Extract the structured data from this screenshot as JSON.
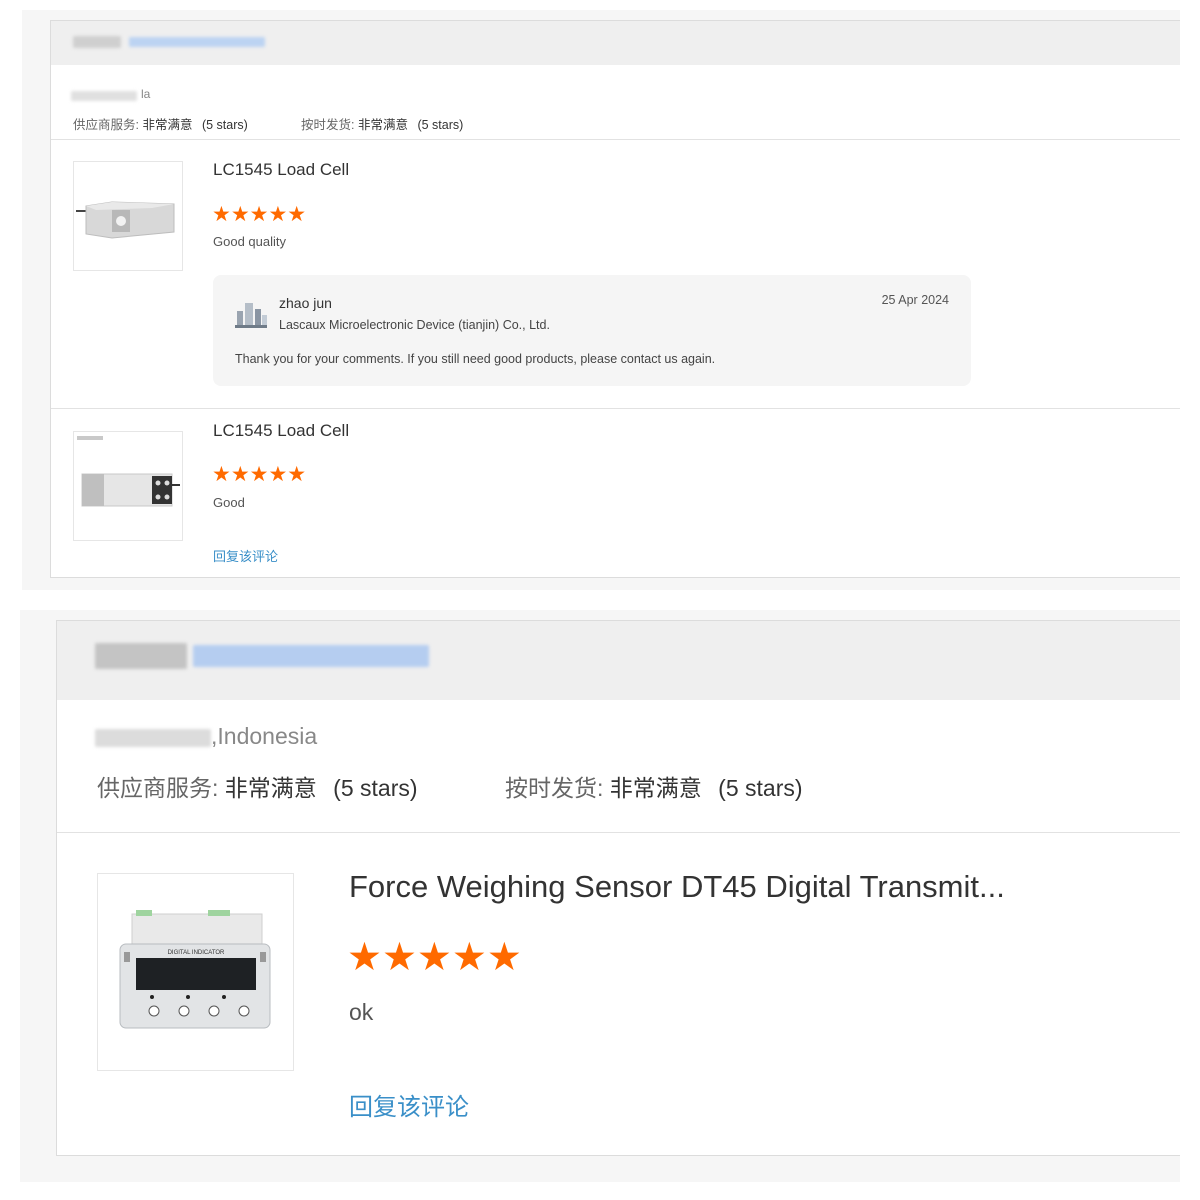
{
  "review1": {
    "location_suffix": "la",
    "ratings": [
      {
        "label": "供应商服务:",
        "value": "非常满意",
        "stars": "(5 stars)"
      },
      {
        "label": "按时发货:",
        "value": "非常满意",
        "stars": "(5 stars)"
      }
    ],
    "items": [
      {
        "product": "LC1545 Load Cell",
        "rating": 5,
        "stars": "★★★★★",
        "comment": "Good quality",
        "reply": {
          "author": "zhao jun",
          "company": "Lascaux Microelectronic Device (tianjin) Co., Ltd.",
          "date": "25 Apr 2024",
          "text": "Thank you for your comments. If you still need good products, please contact us again."
        }
      },
      {
        "product": "LC1545 Load Cell",
        "rating": 5,
        "stars": "★★★★★",
        "comment": "Good",
        "reply_link": "回复该评论"
      }
    ]
  },
  "review2": {
    "location_suffix": ",Indonesia",
    "ratings": [
      {
        "label": "供应商服务:",
        "value": "非常满意",
        "stars": "(5 stars)"
      },
      {
        "label": "按时发货:",
        "value": "非常满意",
        "stars": "(5 stars)"
      }
    ],
    "item": {
      "product": "Force Weighing Sensor DT45 Digital Transmit...",
      "rating": 5,
      "stars": "★★★★★",
      "comment": "ok",
      "reply_link": "回复该评论",
      "display_label": "DIGITAL INDICATOR"
    }
  },
  "colors": {
    "star": "#ff6a00",
    "link": "#3a8fc8",
    "header_bg": "#efefef",
    "reply_bg": "#f5f5f5"
  },
  "icons": [
    "star-icon",
    "avatar-icon",
    "load-cell-image",
    "digital-indicator-image"
  ]
}
